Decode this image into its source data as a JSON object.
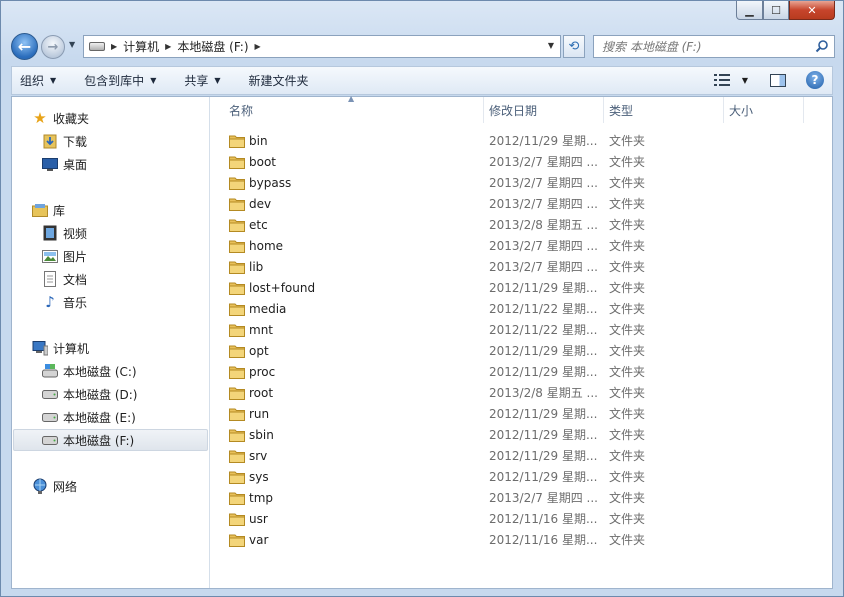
{
  "address": {
    "crumbs": [
      "计算机",
      "本地磁盘 (F:)"
    ]
  },
  "search": {
    "placeholder": "搜索 本地磁盘 (F:)"
  },
  "toolbar": {
    "organize": "组织",
    "include_library": "包含到库中",
    "share": "共享",
    "new_folder": "新建文件夹"
  },
  "nav": {
    "favorites": "收藏夹",
    "downloads": "下载",
    "desktop": "桌面",
    "libraries": "库",
    "videos": "视频",
    "pictures": "图片",
    "documents": "文档",
    "music": "音乐",
    "computer": "计算机",
    "drive_c": "本地磁盘 (C:)",
    "drive_d": "本地磁盘 (D:)",
    "drive_e": "本地磁盘 (E:)",
    "drive_f": "本地磁盘 (F:)",
    "network": "网络"
  },
  "columns": {
    "name": "名称",
    "date": "修改日期",
    "type": "类型",
    "size": "大小"
  },
  "files": [
    {
      "name": "bin",
      "date": "2012/11/29 星期...",
      "type": "文件夹"
    },
    {
      "name": "boot",
      "date": "2013/2/7 星期四 ...",
      "type": "文件夹"
    },
    {
      "name": "bypass",
      "date": "2013/2/7 星期四 ...",
      "type": "文件夹"
    },
    {
      "name": "dev",
      "date": "2013/2/7 星期四 ...",
      "type": "文件夹"
    },
    {
      "name": "etc",
      "date": "2013/2/8 星期五 ...",
      "type": "文件夹"
    },
    {
      "name": "home",
      "date": "2013/2/7 星期四 ...",
      "type": "文件夹"
    },
    {
      "name": "lib",
      "date": "2013/2/7 星期四 ...",
      "type": "文件夹"
    },
    {
      "name": "lost+found",
      "date": "2012/11/29 星期...",
      "type": "文件夹"
    },
    {
      "name": "media",
      "date": "2012/11/22 星期...",
      "type": "文件夹"
    },
    {
      "name": "mnt",
      "date": "2012/11/22 星期...",
      "type": "文件夹"
    },
    {
      "name": "opt",
      "date": "2012/11/29 星期...",
      "type": "文件夹"
    },
    {
      "name": "proc",
      "date": "2012/11/29 星期...",
      "type": "文件夹"
    },
    {
      "name": "root",
      "date": "2013/2/8 星期五 ...",
      "type": "文件夹"
    },
    {
      "name": "run",
      "date": "2012/11/29 星期...",
      "type": "文件夹"
    },
    {
      "name": "sbin",
      "date": "2012/11/29 星期...",
      "type": "文件夹"
    },
    {
      "name": "srv",
      "date": "2012/11/29 星期...",
      "type": "文件夹"
    },
    {
      "name": "sys",
      "date": "2012/11/29 星期...",
      "type": "文件夹"
    },
    {
      "name": "tmp",
      "date": "2013/2/7 星期四 ...",
      "type": "文件夹"
    },
    {
      "name": "usr",
      "date": "2012/11/16 星期...",
      "type": "文件夹"
    },
    {
      "name": "var",
      "date": "2012/11/16 星期...",
      "type": "文件夹"
    }
  ]
}
